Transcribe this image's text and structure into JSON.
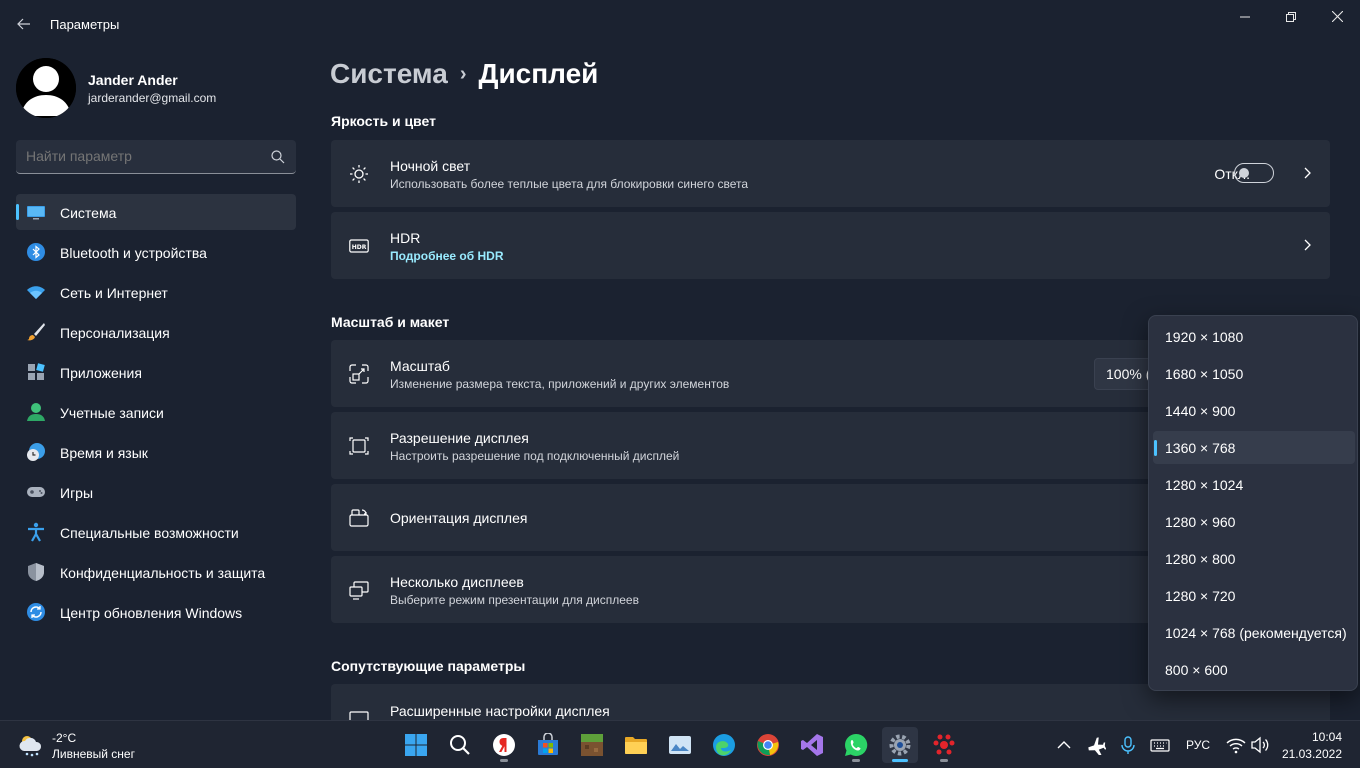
{
  "window": {
    "title": "Параметры",
    "minimize_label": "—",
    "maximize_label": "❐",
    "close_label": "✕"
  },
  "profile": {
    "name": "Jander Ander",
    "email": "jarderander@gmail.com"
  },
  "search": {
    "placeholder": "Найти параметр"
  },
  "sidebar": {
    "items": [
      {
        "label": "Система",
        "icon": "monitor-icon",
        "active": true
      },
      {
        "label": "Bluetooth и устройства",
        "icon": "bluetooth-icon"
      },
      {
        "label": "Сеть и Интернет",
        "icon": "wifi-icon"
      },
      {
        "label": "Персонализация",
        "icon": "brush-icon"
      },
      {
        "label": "Приложения",
        "icon": "apps-icon"
      },
      {
        "label": "Учетные записи",
        "icon": "person-icon"
      },
      {
        "label": "Время и язык",
        "icon": "globe-clock-icon"
      },
      {
        "label": "Игры",
        "icon": "gamepad-icon"
      },
      {
        "label": "Специальные возможности",
        "icon": "accessibility-icon"
      },
      {
        "label": "Конфиденциальность и защита",
        "icon": "shield-icon"
      },
      {
        "label": "Центр обновления Windows",
        "icon": "update-icon"
      }
    ]
  },
  "breadcrumb": {
    "parent": "Система",
    "separator": "›",
    "current": "Дисплей"
  },
  "sections": {
    "brightness": "Яркость и цвет",
    "scale_layout": "Масштаб и макет",
    "related": "Сопутствующие параметры"
  },
  "night_light": {
    "title": "Ночной свет",
    "subtitle": "Использовать более теплые цвета для блокировки синего света",
    "state": "Откл."
  },
  "hdr": {
    "title": "HDR",
    "link": "Подробнее об HDR"
  },
  "scale": {
    "title": "Масштаб",
    "subtitle": "Изменение размера текста, приложений и других элементов",
    "value": "100% ("
  },
  "resolution": {
    "title": "Разрешение дисплея",
    "subtitle": "Настроить разрешение под подключенный дисплей"
  },
  "orientation": {
    "title": "Ориентация дисплея"
  },
  "multiple_displays": {
    "title": "Несколько дисплеев",
    "subtitle": "Выберите режим презентации для дисплеев"
  },
  "advanced": {
    "title": "Расширенные настройки дисплея"
  },
  "resolution_dropdown": {
    "selected_index": 3,
    "options": [
      "1920 × 1080",
      "1680 × 1050",
      "1440 × 900",
      "1360 × 768",
      "1280 × 1024",
      "1280 × 960",
      "1280 × 800",
      "1280 × 720",
      "1024 × 768 (рекомендуется)",
      "800 × 600"
    ]
  },
  "taskbar": {
    "weather_temp": "-2°C",
    "weather_desc": "Ливневый снег",
    "language": "РУС",
    "time": "10:04",
    "date": "21.03.2022"
  },
  "colors": {
    "accent": "#4cc2ff",
    "background": "#1b2230",
    "card": "#262d3a",
    "link": "#99ebff"
  }
}
